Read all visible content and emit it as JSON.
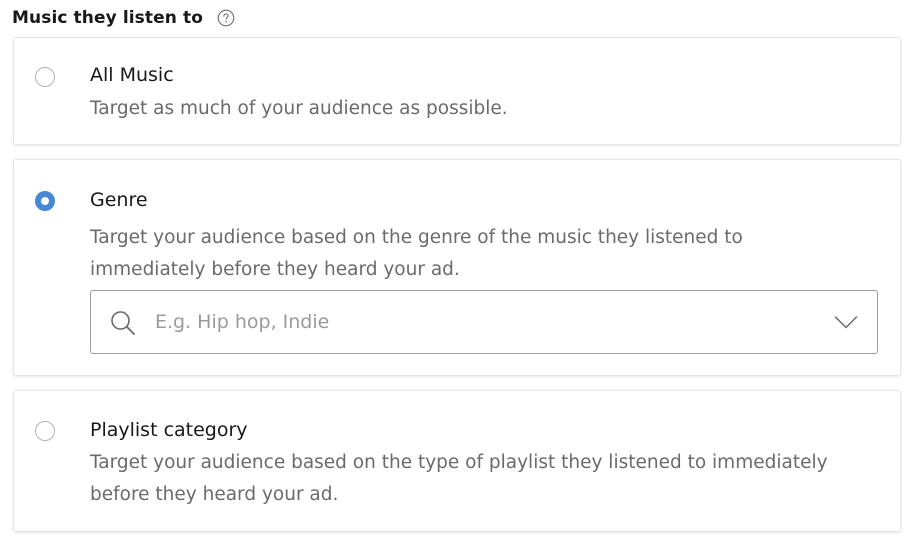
{
  "section": {
    "title": "Music they listen to",
    "help_icon": "question-circle-icon"
  },
  "options": {
    "all_music": {
      "title": "All Music",
      "description": [
        "Target as much of your audience as possible."
      ],
      "selected": false
    },
    "genre": {
      "title": "Genre",
      "description": [
        "Target your audience based on the genre of the music they listened to",
        "immediately before they heard your ad."
      ],
      "selected": true,
      "select": {
        "value": "",
        "placeholder": "E.g. Hip hop, Indie",
        "left_icon": "search-icon",
        "right_icon": "chevron-down-icon"
      }
    },
    "playlist_category": {
      "title": "Playlist category",
      "description": [
        "Target your audience based on the type of playlist they listened to immediately",
        "before they heard your ad."
      ],
      "selected": false
    }
  },
  "colors": {
    "accent": "#4687d6",
    "text_primary": "#181818",
    "text_secondary": "#6a6a6a",
    "border": "#e6e6e6"
  }
}
